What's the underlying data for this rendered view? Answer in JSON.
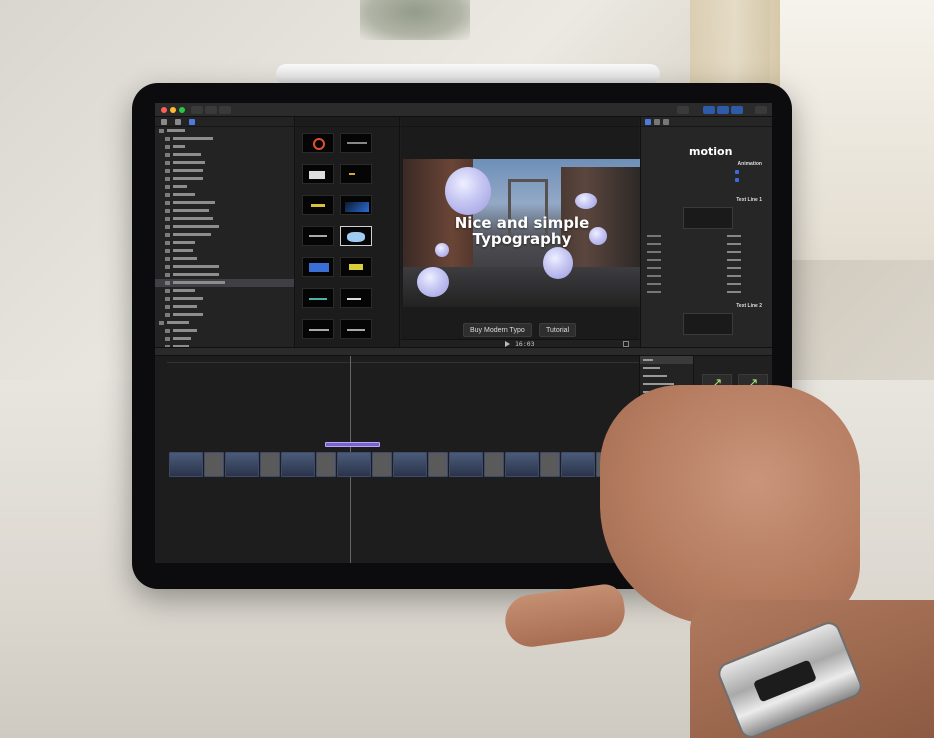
{
  "viewer": {
    "video_title_line1": "Nice and simple",
    "video_title_line2": "Typography",
    "buy_button_label": "Buy Modern Typo",
    "tutorial_button_label": "Tutorial",
    "timecode": "16:03"
  },
  "inspector": {
    "logo_text": "motion",
    "section_animation": "Animation",
    "section_text_line_1": "Text Line 1",
    "section_text_line_2": "Text Line 2"
  },
  "colors": {
    "accent_blue": "#3e6bd6",
    "title_clip": "#7a62c8",
    "fx_arrow": "#a7e27a"
  },
  "icons": {
    "sidebar_toolbar": [
      "library-icon",
      "photos-icon",
      "titles-icon"
    ],
    "fx_tiles": [
      "arrow-diagonal-icon",
      "arrow-left-icon",
      "arrow-double-icon",
      "arrow-right-icon",
      "arrow-curve-icon"
    ]
  }
}
